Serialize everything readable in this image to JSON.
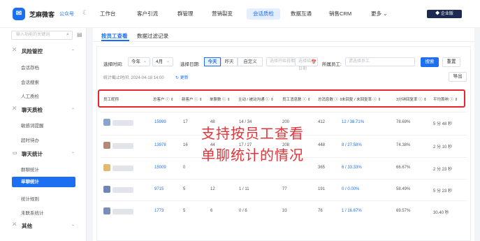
{
  "app": {
    "brand": "芝麻微客",
    "brand_sub": "公众号",
    "theme_icon": "moon-icon",
    "enterprise_badge": "◆ 企业版"
  },
  "top_nav": [
    "工作台",
    "客户引流",
    "群管理",
    "营销裂变",
    "会话质检",
    "数据互通",
    "销售CRM",
    "更多 ⌄"
  ],
  "sidebar": {
    "search_placeholder": "输入功能的关键词",
    "groups": [
      {
        "icon": "⛌",
        "label": "风险管控",
        "items": [
          "会话存档",
          "会话搜索",
          "人工质检"
        ]
      },
      {
        "icon": "⛌",
        "label": "聊天质检",
        "items": [
          "敏感词提醒",
          "超时待办"
        ]
      },
      {
        "icon": "▭",
        "label": "聊天统计",
        "items": [
          "群聊统计",
          "单聊统计",
          "统计规则",
          "未联系统计"
        ]
      },
      {
        "icon": "⛌",
        "label": "其他",
        "items": []
      }
    ],
    "active_item": "单聊统计"
  },
  "tabs": [
    "按员工查看",
    "数据过滤记录"
  ],
  "filters": {
    "time_label": "选择时间:",
    "year_value": "今年",
    "month_value": "4月",
    "date_label": "选择日期:",
    "date_options": [
      "今天",
      "昨天",
      "自定义"
    ],
    "start_placeholder": "选择开始日期",
    "end_placeholder": "选择结束日期",
    "calendar_icon": "📅",
    "staff_label": "所属员工:",
    "staff_placeholder": "请选择员工",
    "search_btn": "搜索",
    "reset_btn": "重置",
    "export_btn": "导出",
    "stat_time": "统计截止时间: 2024-04-18 14:00",
    "refresh": "↻ 更新"
  },
  "table": {
    "headers": [
      "员工昵称",
      "总客户 ⓘ ⇕",
      "新客户 ⓘ ⇕",
      "单聊数 ⓘ ⇕",
      "主动 / 被动沟通 ⓘ ⇕",
      "员工消息数 ⓘ ⇕",
      "总消息数 ⓘ ⇕",
      "未回复 / 未回复率 ⓘ ⇕",
      "3分钟回复率 ⓘ ⇕",
      "平均首响 ⓘ ⇕"
    ],
    "rows": [
      [
        "",
        "15999",
        "17",
        "48",
        "14 / 34",
        "200",
        "412",
        "12 / 38.71%",
        "78.69%",
        "5 分 48 秒"
      ],
      [
        "",
        "13978",
        "16",
        "44",
        "17 / 27",
        "208",
        "448",
        "8 / 27.58%",
        "74.38%",
        "2 分 10 秒"
      ],
      [
        "",
        "15009",
        "0",
        "",
        "",
        "",
        "365",
        "6 / 33.33%",
        "66.67%",
        "2 分 23 秒"
      ],
      [
        "",
        "9715",
        "5",
        "12",
        "1 / 11",
        "77",
        "191",
        "0 / 0.00%",
        "58.49%",
        "5 分 23 秒"
      ],
      [
        "",
        "1773",
        "5",
        "6",
        "0 / 6",
        "33",
        "76",
        "1 / 16.67%",
        "69.57%",
        "30.40 秒"
      ]
    ],
    "avatar_colors": [
      "#8aa3c9",
      "#b08a72",
      "#e5b872",
      "#6f86b5",
      "#7a8fb8"
    ]
  },
  "overlay": {
    "line1": "支持按员工查看",
    "line2": "单聊统计的情况"
  }
}
